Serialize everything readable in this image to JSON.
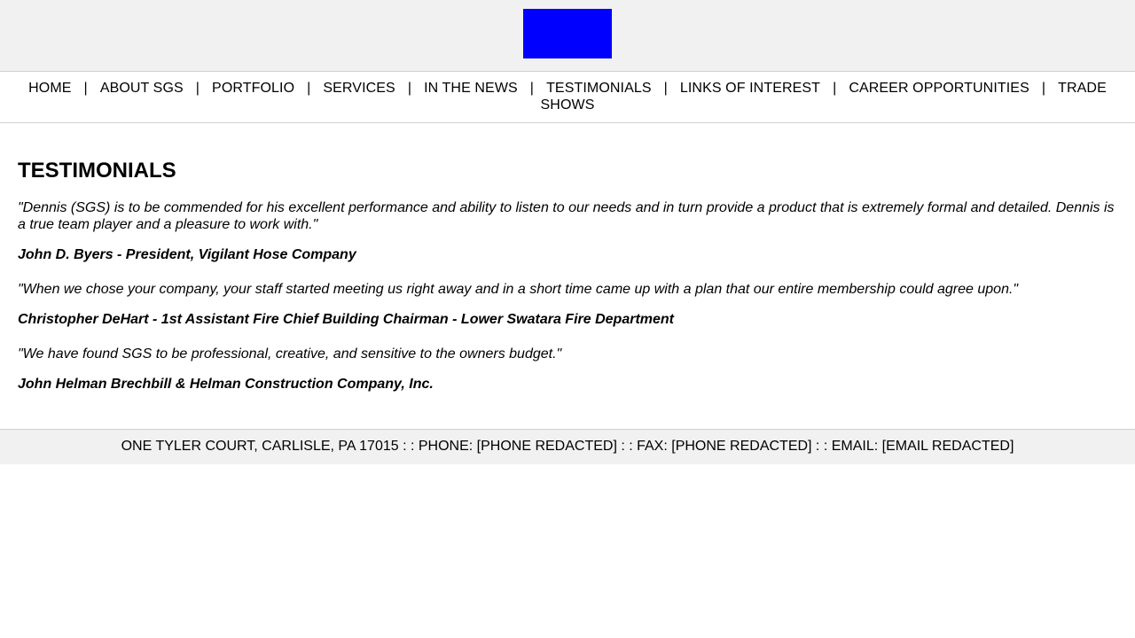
{
  "header": {
    "logo_color": "#0000ff"
  },
  "nav": {
    "items": [
      "HOME",
      "ABOUT SGS",
      "PORTFOLIO",
      "SERVICES",
      "IN THE NEWS",
      "TESTIMONIALS",
      "LINKS OF INTEREST",
      "CAREER OPPORTUNITIES",
      "TRADE SHOWS"
    ],
    "separator": "|"
  },
  "main": {
    "title": "TESTIMONIALS",
    "testimonials": [
      {
        "quote": "\"Dennis (SGS) is to be commended for his excellent performance and ability to listen to our needs and in turn provide a product that is extremely formal and detailed. Dennis is a true team player and a pleasure to work with.\"",
        "author": "John D. Byers - President, Vigilant Hose Company"
      },
      {
        "quote": "\"When we chose your company, your staff started meeting us right away and in a short time came up with a plan that our entire membership could agree upon.\"",
        "author": "Christopher DeHart - 1st Assistant Fire Chief Building Chairman - Lower Swatara Fire Department"
      },
      {
        "quote": "\"We have found SGS to be professional, creative, and sensitive to the owners budget.\"",
        "author": "John Helman Brechbill & Helman Construction Company, Inc."
      }
    ]
  },
  "footer": {
    "text": "ONE TYLER COURT, CARLISLE, PA 17015 : : PHONE: [PHONE REDACTED] : : FAX: [PHONE REDACTED] : : EMAIL: [EMAIL REDACTED]"
  }
}
